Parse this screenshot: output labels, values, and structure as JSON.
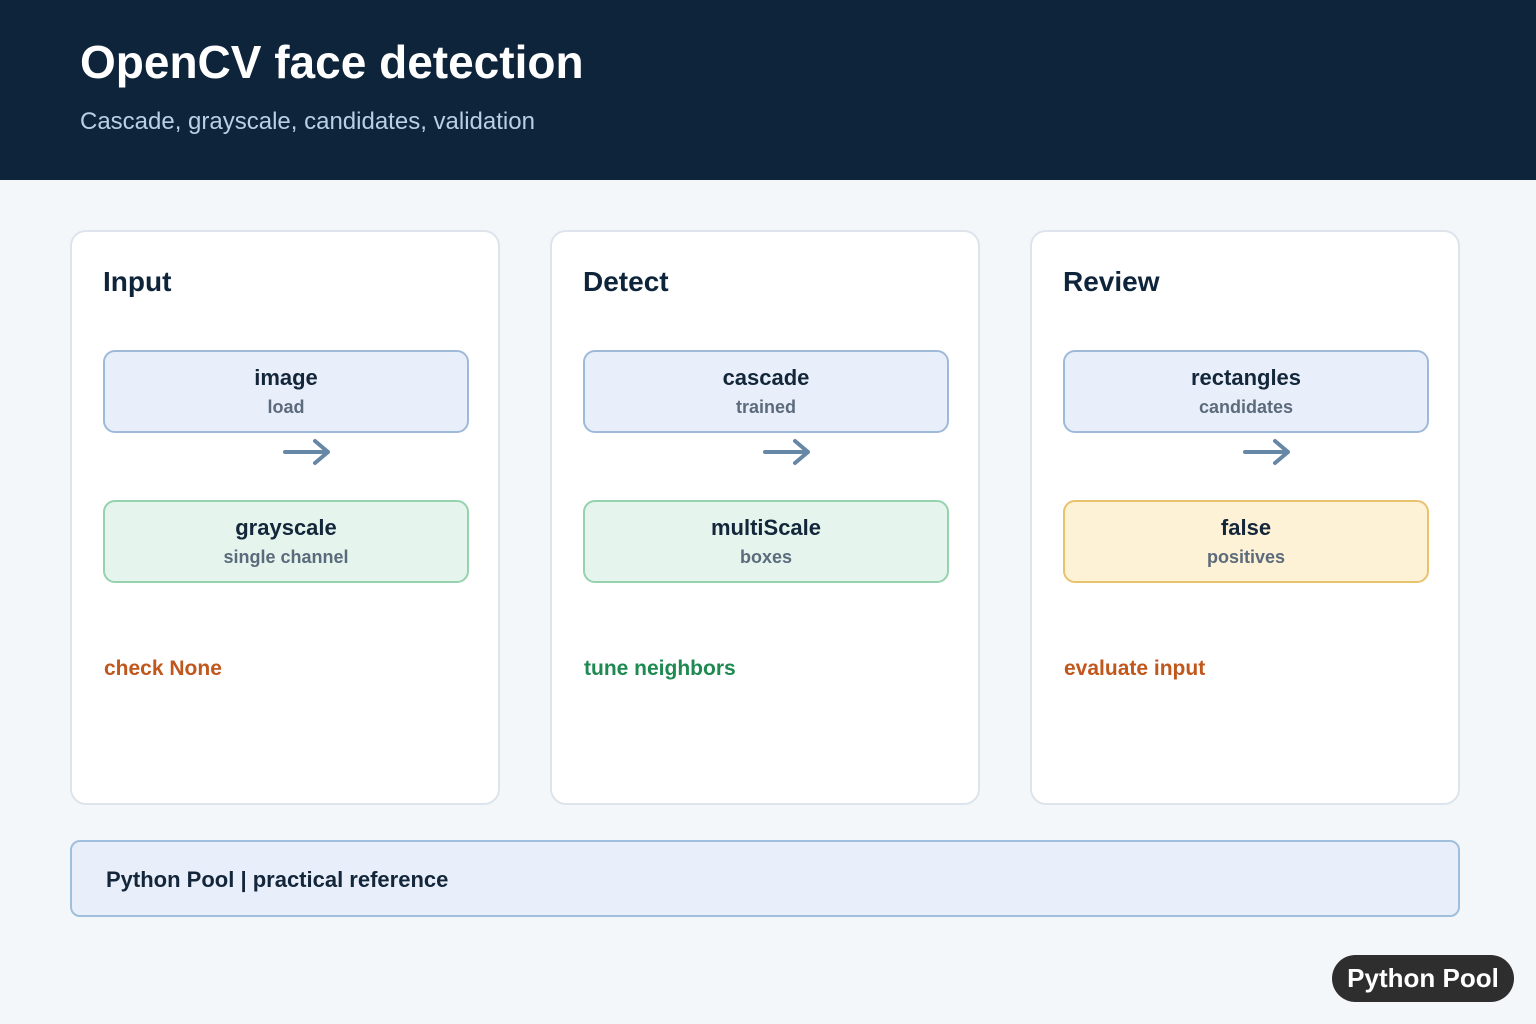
{
  "header": {
    "title": "OpenCV face detection",
    "subtitle": "Cascade, grayscale, candidates, validation"
  },
  "colors": {
    "header_bg": "#0e243b",
    "page_bg": "#f4f7fa",
    "arrow": "#6787a6",
    "note_orange": "#c0571d",
    "note_green": "#1e8a52",
    "node_blue": "#e8effa",
    "node_green": "#e5f5ee",
    "node_amber": "#fef2d6"
  },
  "panels": [
    {
      "title": "Input",
      "top_node": {
        "label": "image",
        "sub": "load",
        "tone": "blue"
      },
      "bottom_node": {
        "label": "grayscale",
        "sub": "single channel",
        "tone": "green"
      },
      "arrow_icon": "arrow-right-icon",
      "note": {
        "text": "check None",
        "color": "#c0571d"
      }
    },
    {
      "title": "Detect",
      "top_node": {
        "label": "cascade",
        "sub": "trained",
        "tone": "blue"
      },
      "bottom_node": {
        "label": "multiScale",
        "sub": "boxes",
        "tone": "green"
      },
      "arrow_icon": "arrow-right-icon",
      "note": {
        "text": "tune neighbors",
        "color": "#1e8a52"
      }
    },
    {
      "title": "Review",
      "top_node": {
        "label": "rectangles",
        "sub": "candidates",
        "tone": "blue"
      },
      "bottom_node": {
        "label": "false",
        "sub": "positives",
        "tone": "amber"
      },
      "arrow_icon": "arrow-right-icon",
      "note": {
        "text": "evaluate input",
        "color": "#c0571d"
      }
    }
  ],
  "footer": {
    "text": "Python Pool | practical reference"
  },
  "badge": {
    "text": "Python Pool"
  }
}
